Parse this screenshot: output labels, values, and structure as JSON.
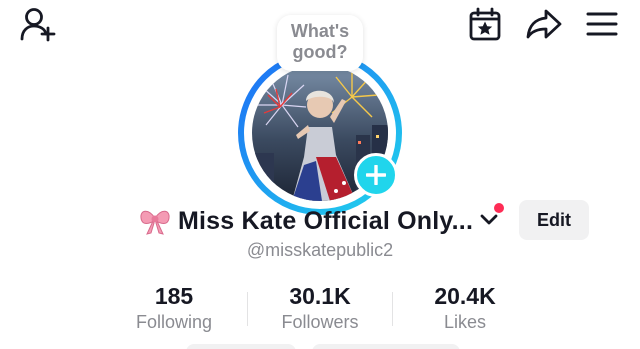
{
  "header": {
    "icons": [
      "add-user-icon",
      "calendar-star-icon",
      "share-icon",
      "menu-icon"
    ]
  },
  "avatar": {
    "bubble_lines": [
      "What's",
      "good?"
    ],
    "ring_colors": [
      "#1e6cf5",
      "#20d5ec"
    ]
  },
  "profile": {
    "name_emoji": "🎀",
    "display_name": "Miss Kate Official Only...",
    "username": "@misskatepublic2",
    "edit_label": "Edit"
  },
  "stats": [
    {
      "value": "185",
      "label": "Following"
    },
    {
      "value": "30.1K",
      "label": "Followers"
    },
    {
      "value": "20.4K",
      "label": "Likes"
    }
  ],
  "colors": {
    "accent_cyan": "#20d5ec",
    "notification": "#fe2c55",
    "secondary_text": "#8a8b91"
  }
}
